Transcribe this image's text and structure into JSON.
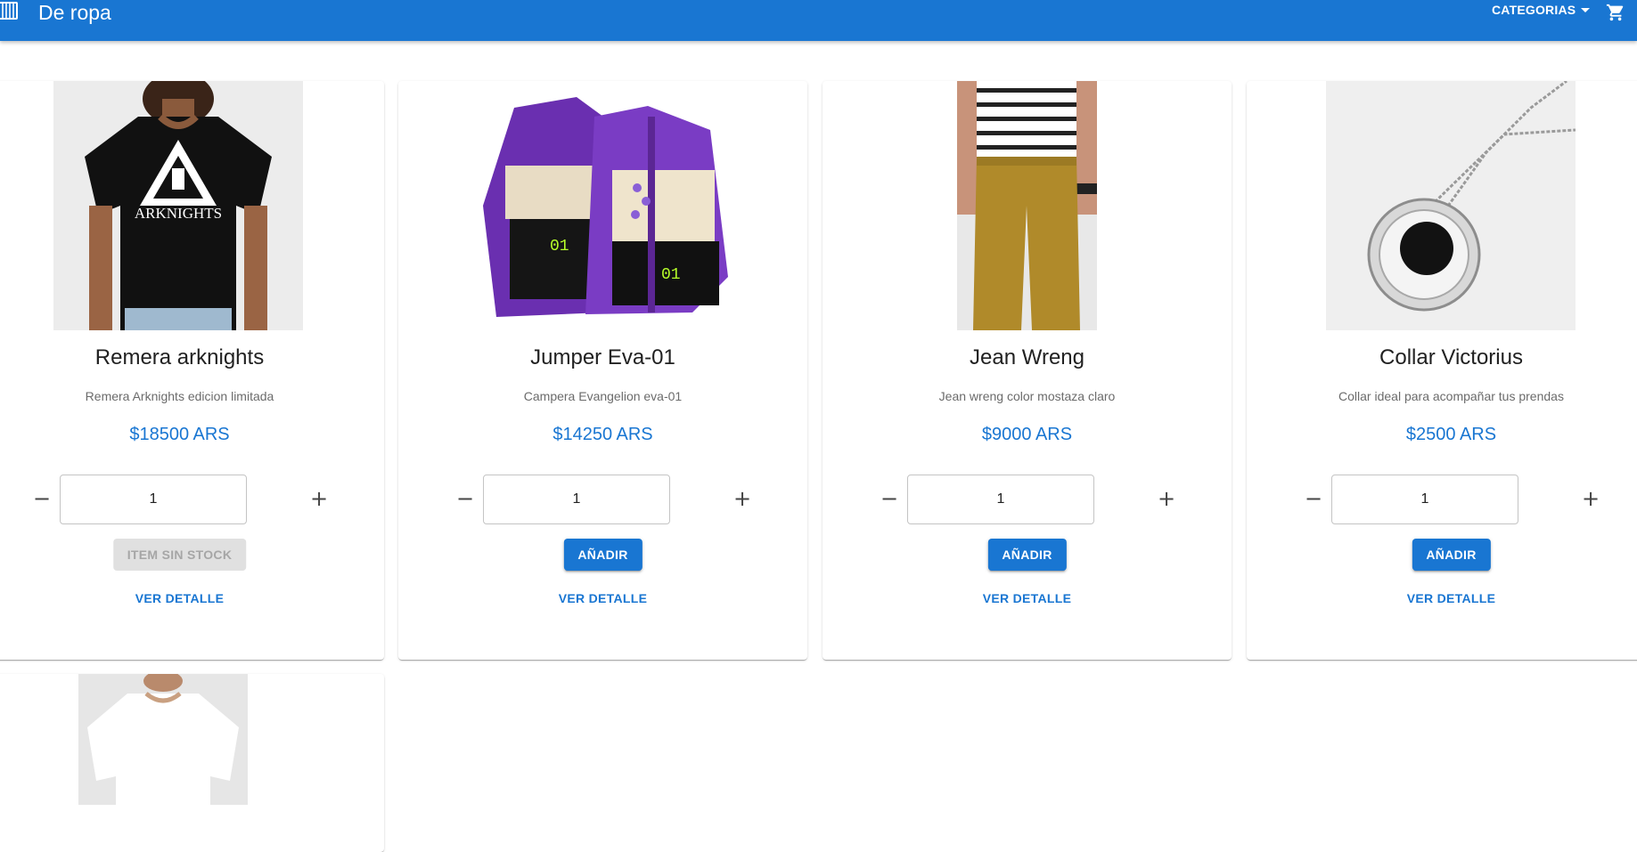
{
  "header": {
    "brand": "De ropa",
    "categories_label": "CATEGORIAS",
    "logo_icon": "store-logo-icon",
    "cart_icon": "shopping-cart-icon",
    "bar_color": "#1976d2"
  },
  "products": [
    {
      "title": "Remera arknights",
      "description": "Remera Arknights edicion limitada",
      "price": "$18500 ARS",
      "quantity": "1",
      "action_label": "ITEM SIN STOCK",
      "action_enabled": false,
      "detail_label": "VER DETALLE",
      "image_icon": "black-tshirt-image",
      "shirt_print": "ARKNIGHTS"
    },
    {
      "title": "Jumper Eva-01",
      "description": "Campera Evangelion eva-01",
      "price": "$14250 ARS",
      "quantity": "1",
      "action_label": "AÑADIR",
      "action_enabled": true,
      "detail_label": "VER DETALLE",
      "image_icon": "purple-jacket-image"
    },
    {
      "title": "Jean Wreng",
      "description": "Jean wreng color mostaza claro",
      "price": "$9000 ARS",
      "quantity": "1",
      "action_label": "AÑADIR",
      "action_enabled": true,
      "detail_label": "VER DETALLE",
      "image_icon": "mustard-jeans-image"
    },
    {
      "title": "Collar Victorius",
      "description": "Collar ideal para acompañar tus prendas",
      "price": "$2500 ARS",
      "quantity": "1",
      "action_label": "AÑADIR",
      "action_enabled": true,
      "detail_label": "VER DETALLE",
      "image_icon": "necklace-image"
    }
  ],
  "partial_product": {
    "image_icon": "white-tshirt-image"
  },
  "colors": {
    "primary": "#1976d2",
    "disabled_bg": "#e0e0e0",
    "disabled_text": "#a6a6a6"
  }
}
